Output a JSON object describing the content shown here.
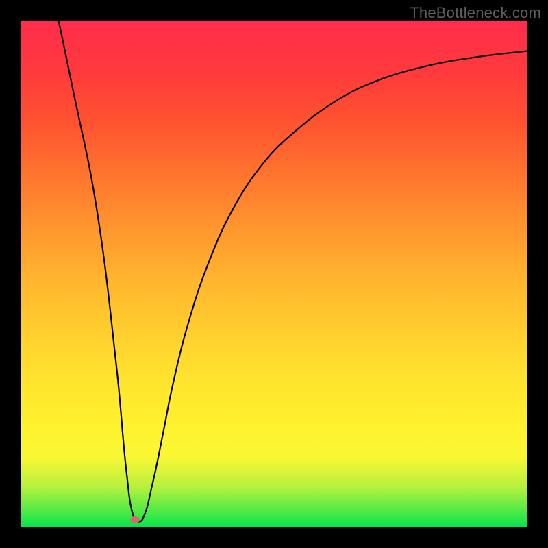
{
  "watermark": "TheBottleneck.com",
  "marker": {
    "x_frac": 0.225,
    "y_frac": 0.985,
    "color": "#d46a6a"
  },
  "chart_data": {
    "type": "line",
    "title": "",
    "xlabel": "",
    "ylabel": "",
    "xlim": [
      0,
      1
    ],
    "ylim": [
      0,
      1
    ],
    "background_gradient": {
      "orientation": "vertical",
      "stops": [
        {
          "pos": 0.0,
          "color": "#00e54b"
        },
        {
          "pos": 0.03,
          "color": "#4bea46"
        },
        {
          "pos": 0.08,
          "color": "#b6f13e"
        },
        {
          "pos": 0.14,
          "color": "#faf733"
        },
        {
          "pos": 0.2,
          "color": "#fff22e"
        },
        {
          "pos": 0.3,
          "color": "#ffe22e"
        },
        {
          "pos": 0.4,
          "color": "#ffcb2e"
        },
        {
          "pos": 0.5,
          "color": "#ffb22e"
        },
        {
          "pos": 0.6,
          "color": "#ff932e"
        },
        {
          "pos": 0.7,
          "color": "#ff732e"
        },
        {
          "pos": 0.8,
          "color": "#ff5230"
        },
        {
          "pos": 0.9,
          "color": "#ff3a3c"
        },
        {
          "pos": 1.0,
          "color": "#ff2c4c"
        }
      ]
    },
    "series": [
      {
        "name": "curve",
        "x": [
          0.075,
          0.1,
          0.15,
          0.19,
          0.21,
          0.225,
          0.24,
          0.26,
          0.28,
          0.3,
          0.33,
          0.37,
          0.42,
          0.48,
          0.54,
          0.62,
          0.7,
          0.8,
          0.9,
          1.0
        ],
        "y": [
          1.0,
          0.88,
          0.63,
          0.31,
          0.1,
          0.015,
          0.015,
          0.085,
          0.18,
          0.28,
          0.4,
          0.52,
          0.63,
          0.72,
          0.78,
          0.84,
          0.88,
          0.91,
          0.928,
          0.94
        ]
      }
    ],
    "marker_point": {
      "x": 0.225,
      "y": 0.015
    },
    "frame": {
      "border_color": "#000000",
      "border_px": 30
    }
  }
}
